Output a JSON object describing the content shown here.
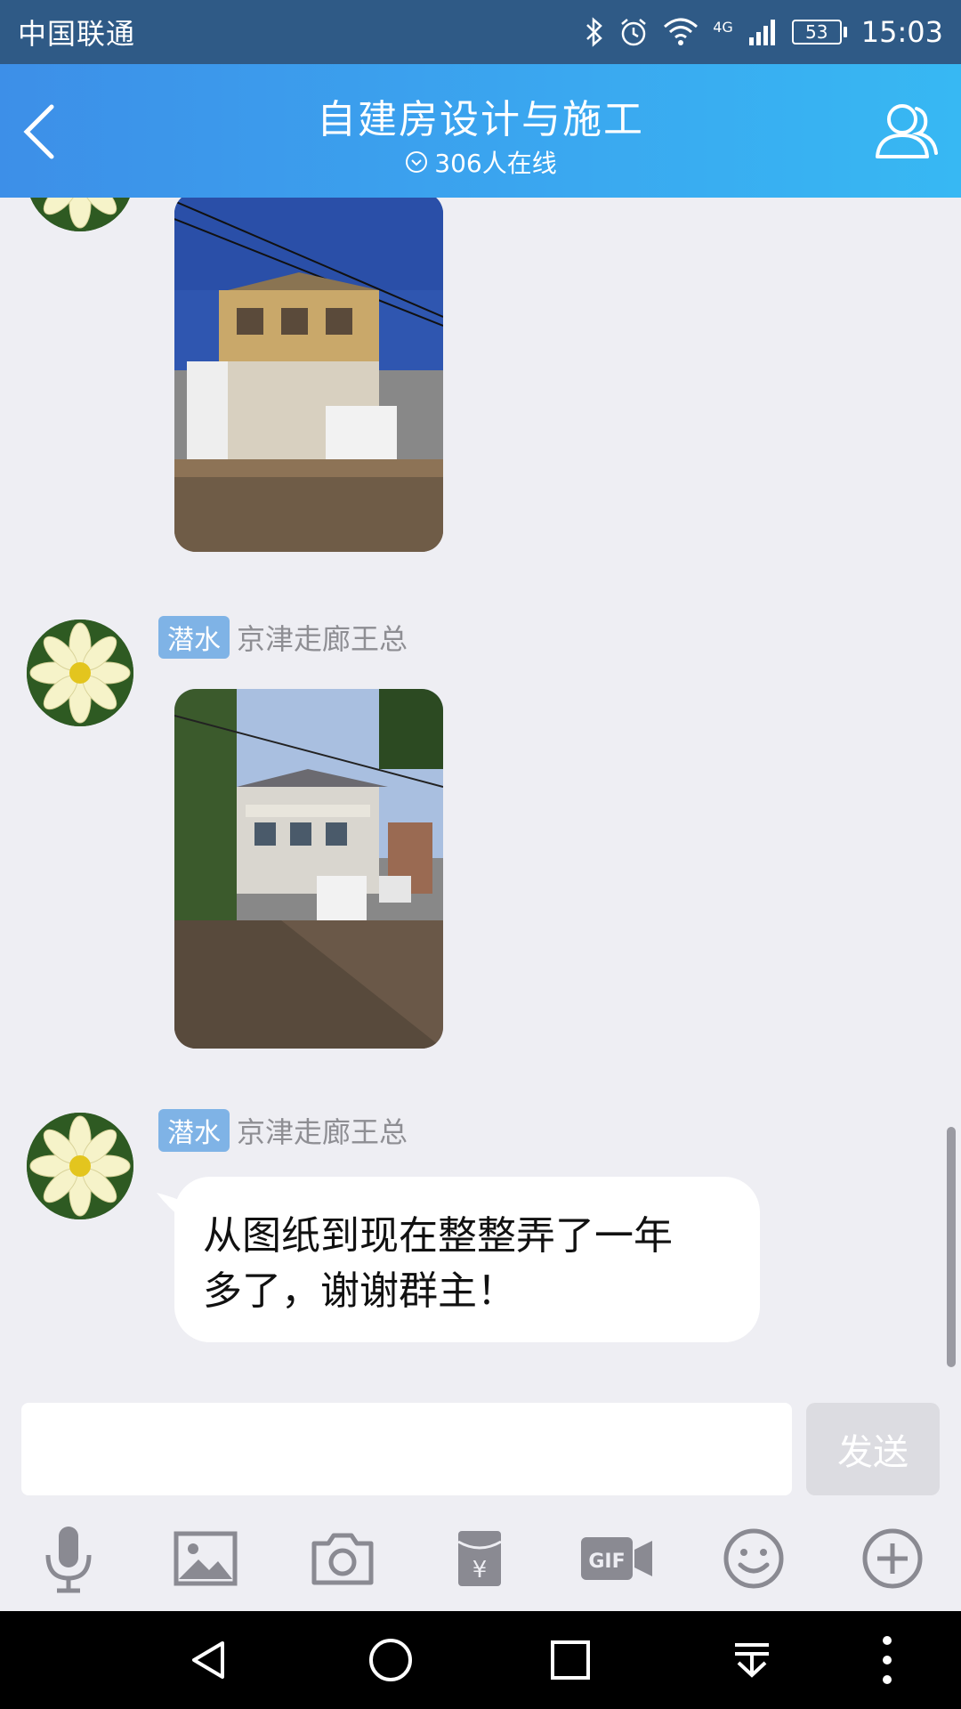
{
  "status_bar": {
    "carrier": "中国联通",
    "network": "4G",
    "battery": "53",
    "time": "15:03"
  },
  "header": {
    "title": "自建房设计与施工",
    "online": "306人在线"
  },
  "messages": [
    {
      "type": "image",
      "description_icon": "photo-house-under-construction"
    },
    {
      "type": "image",
      "badge": "潜水",
      "sender": "京津走廊王总",
      "description_icon": "photo-house-street-view"
    },
    {
      "type": "text",
      "badge": "潜水",
      "sender": "京津走廊王总",
      "text": "从图纸到现在整整弄了一年多了，谢谢群主！"
    }
  ],
  "bubble_lines": [
    "从图纸到现在整整弄了一年",
    "多了，谢谢群主！"
  ],
  "input": {
    "placeholder": "",
    "send_label": "发送"
  },
  "toolbar": [
    "microphone-icon",
    "image-icon",
    "camera-icon",
    "red-packet-icon",
    "gif-icon",
    "emoji-icon",
    "plus-icon"
  ],
  "colors": {
    "header_start": "#3d8fe8",
    "header_end": "#37b8f3",
    "status_bar": "#2f5a86",
    "badge": "#7fb3e6",
    "background": "#eeeef3"
  }
}
